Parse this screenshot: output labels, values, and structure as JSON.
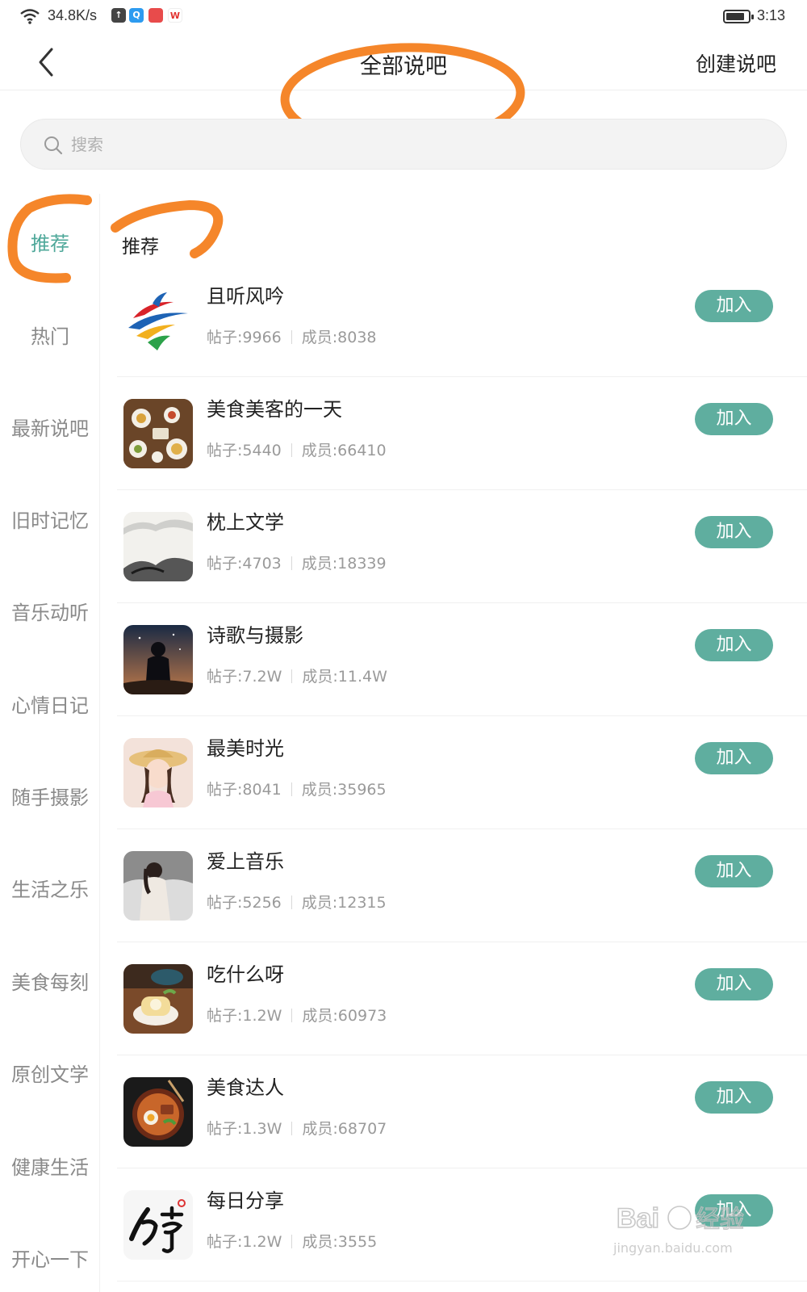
{
  "status_bar": {
    "net_speed": "34.8K/s",
    "time": "3:13",
    "icons": [
      "wifi-icon",
      "upload-icon",
      "search-app-icon",
      "red-app-icon",
      "wps-icon",
      "battery-icon"
    ],
    "mini_icon_labels": [
      "↑",
      "Q",
      "",
      "W"
    ],
    "mini_icon_colors": [
      "#444444",
      "#2d9bf0",
      "#e84b4b",
      "#ffffff"
    ]
  },
  "header": {
    "title": "全部说吧",
    "create_label": "创建说吧"
  },
  "search": {
    "placeholder": "搜索",
    "value": ""
  },
  "sidebar": {
    "active_color": "#4fa89a",
    "items": [
      {
        "label": "推荐"
      },
      {
        "label": "热门"
      },
      {
        "label": "最新说吧"
      },
      {
        "label": "旧时记忆"
      },
      {
        "label": "音乐动听"
      },
      {
        "label": "心情日记"
      },
      {
        "label": "随手摄影"
      },
      {
        "label": "生活之乐"
      },
      {
        "label": "美食每刻"
      },
      {
        "label": "原创文学"
      },
      {
        "label": "健康生活"
      },
      {
        "label": "开心一下"
      }
    ]
  },
  "section": {
    "title": "推荐"
  },
  "accent_color": "#5fae9f",
  "annotation_color": "#f5862a",
  "list": [
    {
      "name": "且听风吟",
      "posts": "帖子:9966",
      "members": "成员:8038",
      "join": "加入",
      "thumb": "logo-ribbon"
    },
    {
      "name": "美食美客的一天",
      "posts": "帖子:5440",
      "members": "成员:66410",
      "join": "加入",
      "thumb": "food-table"
    },
    {
      "name": "枕上文学",
      "posts": "帖子:4703",
      "members": "成员:18339",
      "join": "加入",
      "thumb": "ink-landscape"
    },
    {
      "name": "诗歌与摄影",
      "posts": "帖子:7.2W",
      "members": "成员:11.4W",
      "join": "加入",
      "thumb": "silhouette-night"
    },
    {
      "name": "最美时光",
      "posts": "帖子:8041",
      "members": "成员:35965",
      "join": "加入",
      "thumb": "girl-straw-hat"
    },
    {
      "name": "爱上音乐",
      "posts": "帖子:5256",
      "members": "成员:12315",
      "join": "加入",
      "thumb": "girl-in-snow"
    },
    {
      "name": "吃什么呀",
      "posts": "帖子:1.2W",
      "members": "成员:60973",
      "join": "加入",
      "thumb": "cake-roll"
    },
    {
      "name": "美食达人",
      "posts": "帖子:1.3W",
      "members": "成员:68707",
      "join": "加入",
      "thumb": "noodle-bowl"
    },
    {
      "name": "每日分享",
      "posts": "帖子:1.2W",
      "members": "成员:3555",
      "join": "加入",
      "thumb": "calligraphy-share"
    }
  ],
  "watermark": {
    "logo_text": "Bai 经验",
    "url": "jingyan.baidu.com"
  }
}
